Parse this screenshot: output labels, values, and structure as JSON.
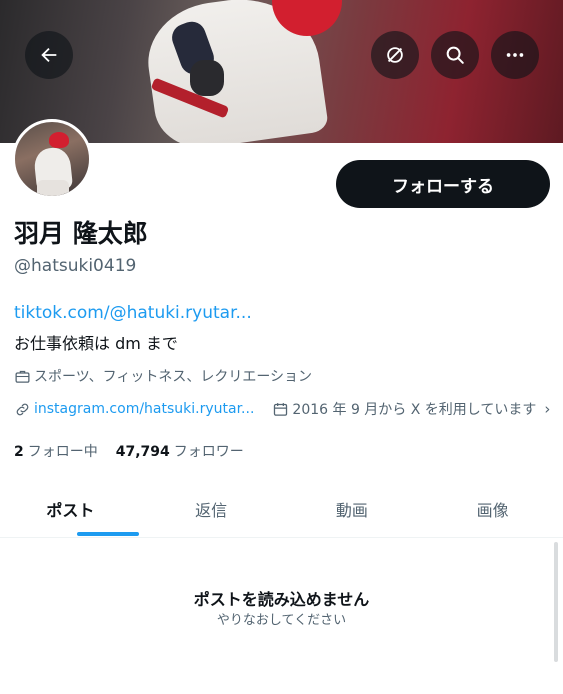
{
  "header": {
    "back_icon": "arrow-left-icon",
    "grok_icon": "grok-slash-circle-icon",
    "search_icon": "search-icon",
    "more_icon": "more-horizontal-icon"
  },
  "profile": {
    "display_name": "羽月 隆太郎",
    "handle": "@hatsuki0419",
    "follow_label": "フォローする",
    "bio_link": "tiktok.com/@hatuki.ryutar...",
    "bio_text": "お仕事依頼は dm まで",
    "category": "スポーツ、フィットネス、レクリエーション",
    "website": "instagram.com/hatsuki.ryutar...",
    "joined": "2016 年 9 月から X を利用しています",
    "following_count": "2",
    "following_label": "フォロー中",
    "followers_count": "47,794",
    "followers_label": "フォロワー"
  },
  "tabs": [
    {
      "label": "ポスト"
    },
    {
      "label": "返信"
    },
    {
      "label": "動画"
    },
    {
      "label": "画像"
    }
  ],
  "empty_state": {
    "title": "ポストを読み込めません",
    "subtitle": "やりなおしてください"
  },
  "colors": {
    "accent": "#1d9bf0",
    "text": "#0f1419",
    "secondary_text": "#536471",
    "button_dark": "#0f1419"
  }
}
